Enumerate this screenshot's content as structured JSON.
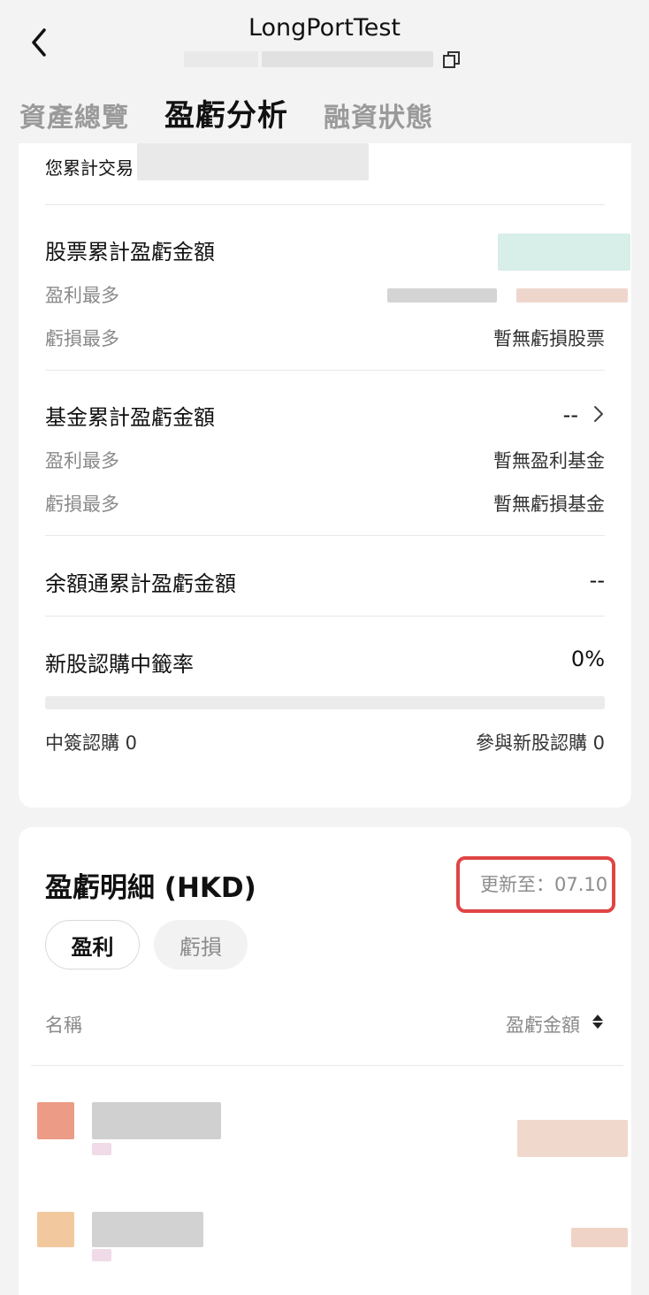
{
  "header": {
    "title": "LongPortTest"
  },
  "tabs": [
    "資產總覽",
    "盈虧分析",
    "融資狀態"
  ],
  "card_top": {
    "cumulative_trade_label": "您累計交易",
    "stock": {
      "title": "股票累計盈虧金額",
      "profit_most_label": "盈利最多",
      "loss_most_label": "虧損最多",
      "loss_most_value": "暫無虧損股票"
    },
    "fund": {
      "title": "基金累計盈虧金額",
      "value": "--",
      "profit_most_label": "盈利最多",
      "profit_most_value": "暫無盈利基金",
      "loss_most_label": "虧損最多",
      "loss_most_value": "暫無虧損基金"
    },
    "yuebao": {
      "title": "余額通累計盈虧金額",
      "value": "--"
    },
    "ipo": {
      "title": "新股認購中籤率",
      "rate": "0%",
      "rate_value": 0,
      "won_label": "中簽認購 0",
      "participated_label": "參與新股認購 0"
    }
  },
  "card_detail": {
    "title": "盈虧明細 (HKD)",
    "updated": "更新至：07.10",
    "filters": [
      "盈利",
      "虧損"
    ],
    "active_filter": "盈利",
    "col_name": "名稱",
    "col_pnl": "盈虧金額"
  },
  "colors": {
    "highlight_border": "#e04545",
    "profit_blur": "#e9c2b2",
    "stock_value_blur": "#cfeae3"
  }
}
